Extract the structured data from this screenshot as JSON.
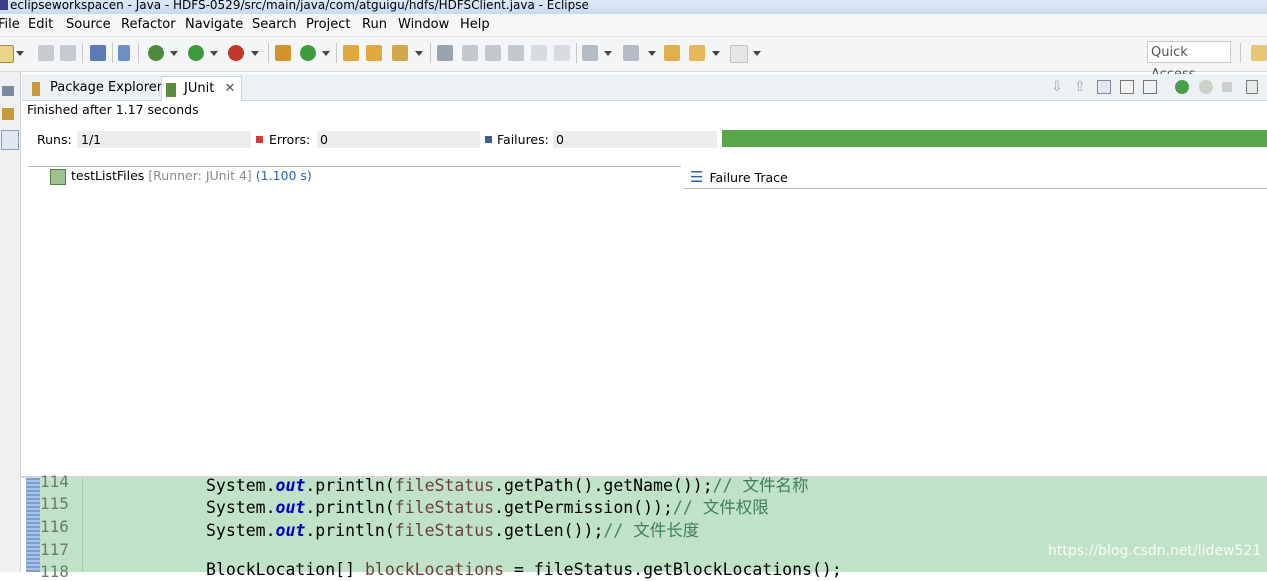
{
  "window": {
    "title": "eclipseworkspacen - Java - HDFS-0529/src/main/java/com/atguigu/hdfs/HDFSClient.java - Eclipse"
  },
  "menu": [
    "File",
    "Edit",
    "Source",
    "Refactor",
    "Navigate",
    "Search",
    "Project",
    "Run",
    "Window",
    "Help"
  ],
  "toolbar": {
    "quick_access": "Quick Access"
  },
  "tabs": [
    {
      "label": "Package Explorer",
      "icon": "package-explorer-icon",
      "active": false
    },
    {
      "label": "JUnit",
      "icon": "junit-icon",
      "active": true
    }
  ],
  "junit": {
    "status": "Finished after 1.17 seconds",
    "runs_label": "Runs:",
    "runs_value": "1/1",
    "errors_label": "Errors:",
    "errors_value": "0",
    "failures_label": "Failures:",
    "failures_value": "0",
    "progress_fraction": 1.0,
    "progress_color": "#57a64a",
    "test": {
      "name": "testListFiles",
      "runner": "[Runner: JUnit 4]",
      "time": "(1.100 s)"
    },
    "failure_trace_label": "Failure Trace"
  },
  "editor": {
    "lines": [
      {
        "num": "114",
        "pre": "System.",
        "field": "out",
        "mid": ".println(",
        "var": "fileStatus",
        "post": ".getPath().getName());",
        "comment": "// 文件名称"
      },
      {
        "num": "115",
        "pre": "System.",
        "field": "out",
        "mid": ".println(",
        "var": "fileStatus",
        "post": ".getPermission());",
        "comment": "// 文件权限"
      },
      {
        "num": "116",
        "pre": "System.",
        "field": "out",
        "mid": ".println(",
        "var": "fileStatus",
        "post": ".getLen());",
        "comment": "// 文件长度"
      },
      {
        "num": "117",
        "pre": "",
        "field": "",
        "mid": "",
        "var": "",
        "post": "",
        "comment": ""
      },
      {
        "num": "118",
        "pre": "BlockLocation[] ",
        "field": "",
        "mid": "",
        "var": "blockLocations",
        "post": " = fileStatus.getBlockLocations();",
        "comment": ""
      }
    ]
  },
  "watermark": "https://blog.csdn.net/lidew521"
}
